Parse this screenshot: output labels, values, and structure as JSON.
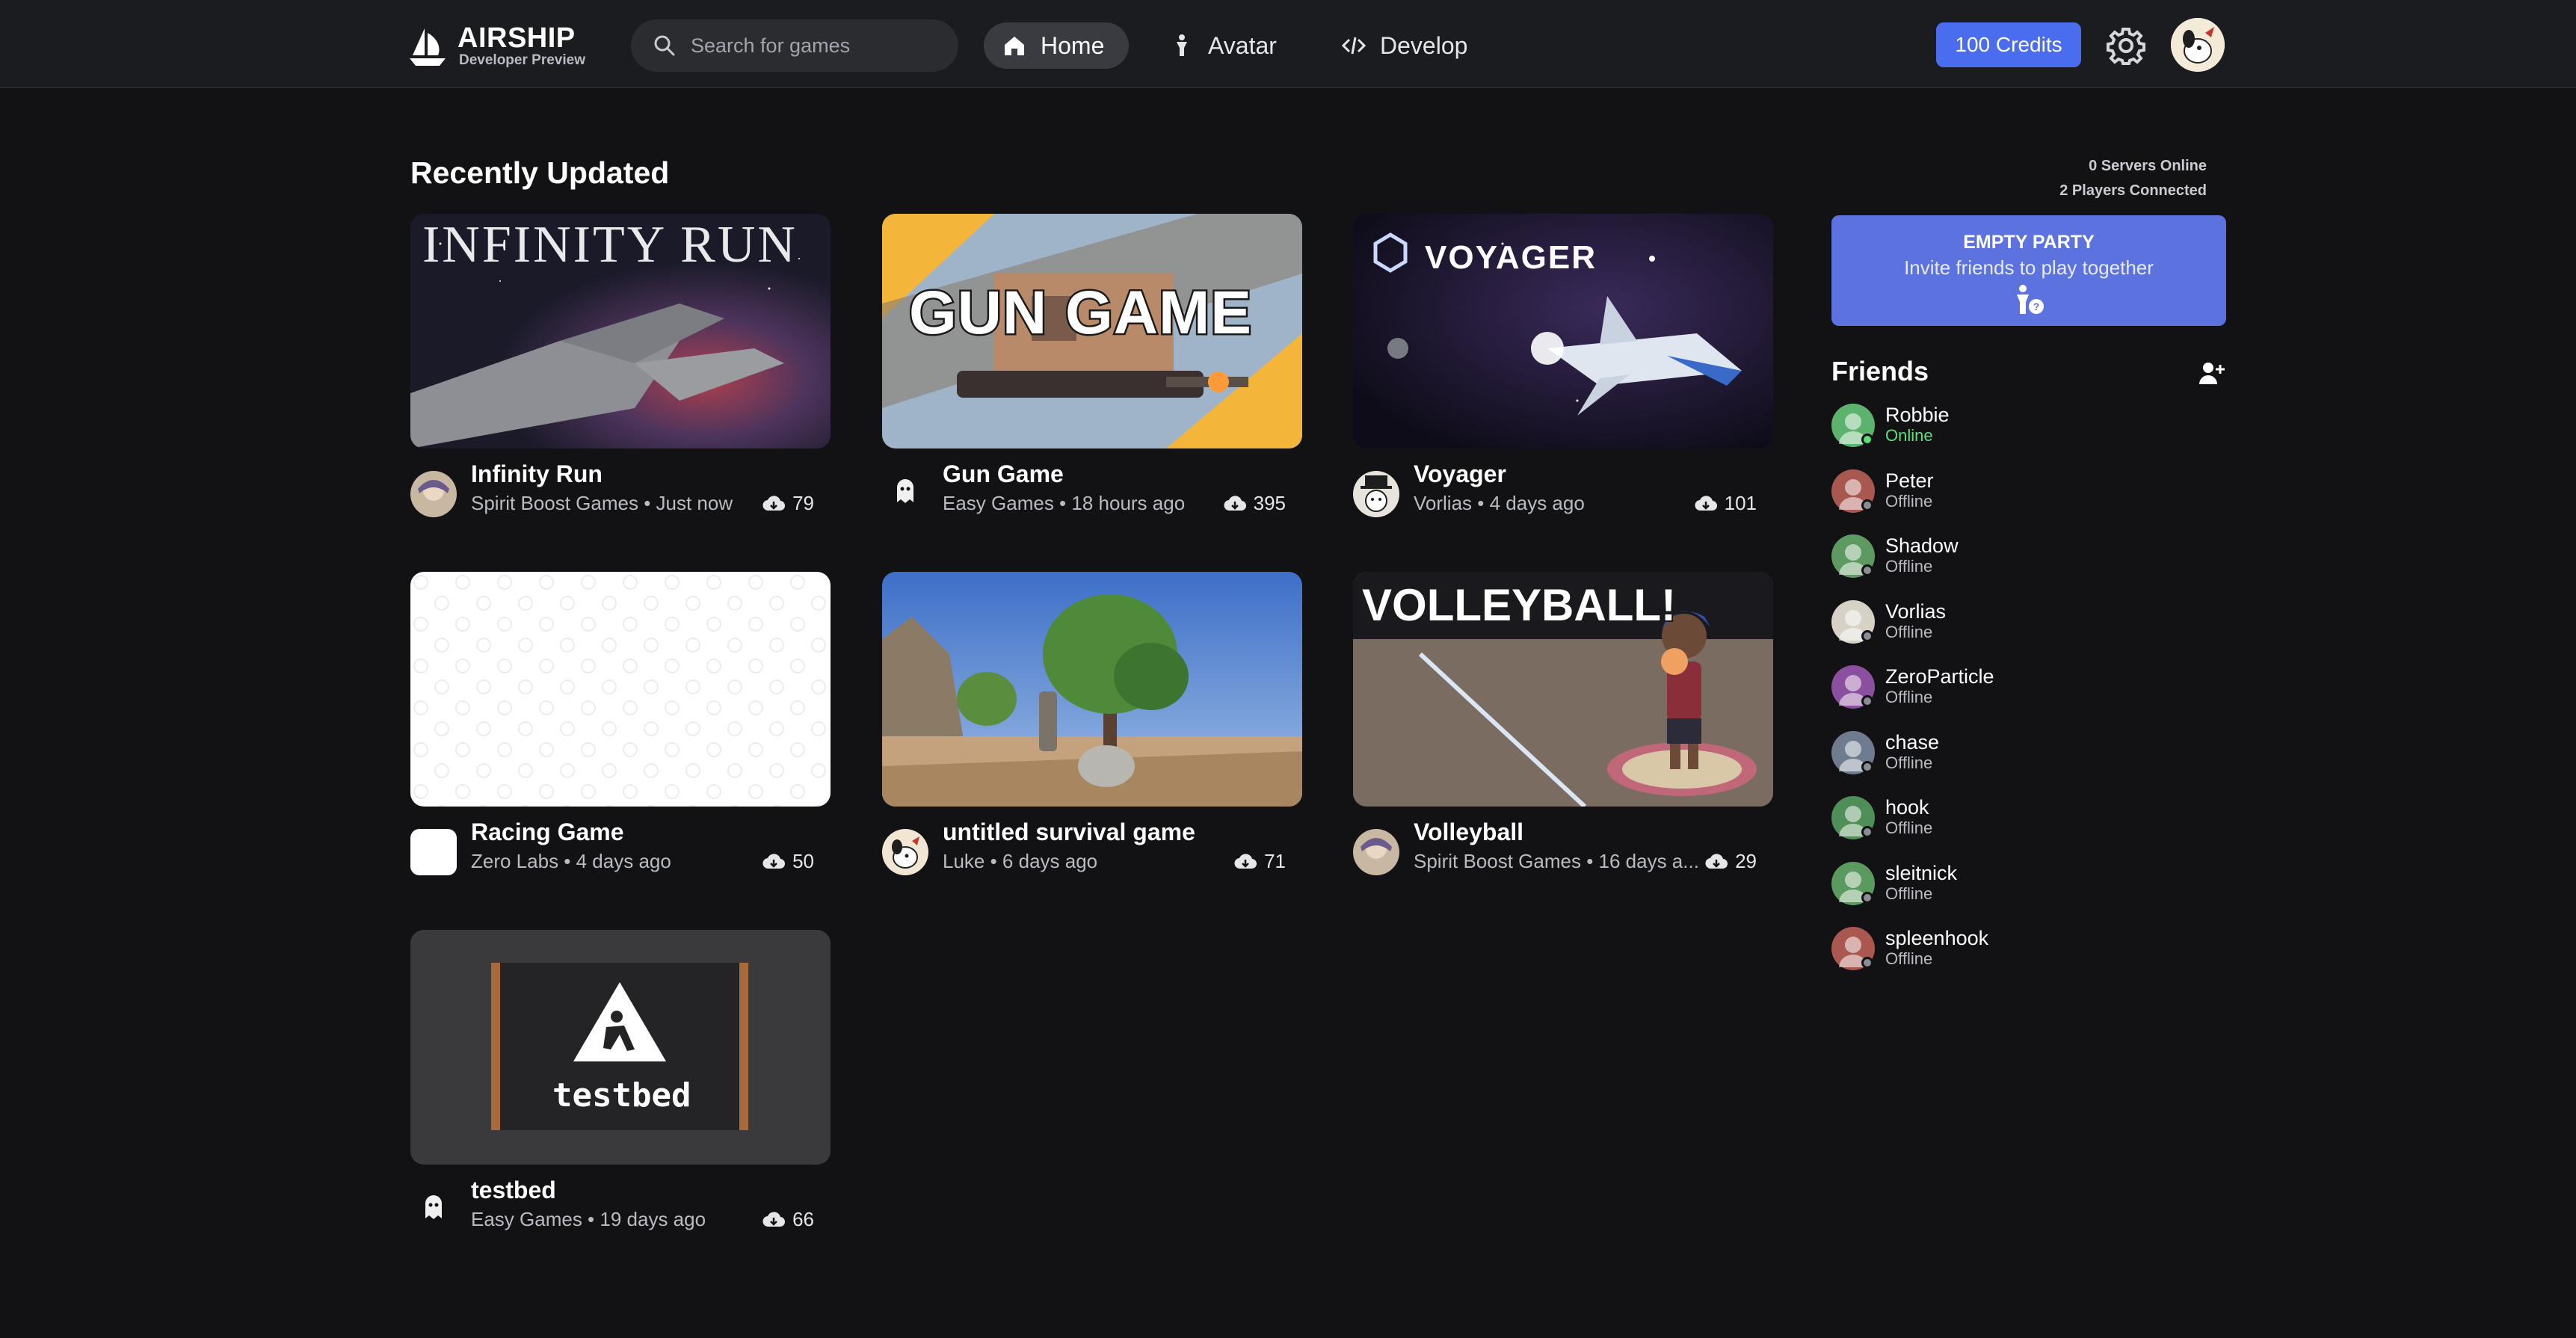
{
  "header": {
    "logo_title": "AIRSHIP",
    "logo_subtitle": "Developer Preview",
    "search_placeholder": "Search for games",
    "nav": [
      {
        "label": "Home",
        "icon": "home-icon",
        "active": true
      },
      {
        "label": "Avatar",
        "icon": "person-icon",
        "active": false
      },
      {
        "label": "Develop",
        "icon": "code-icon",
        "active": false
      }
    ],
    "credits_label": "100 Credits",
    "accent_color": "#4a6df0"
  },
  "main": {
    "section_title": "Recently Updated",
    "games": [
      {
        "name": "Infinity Run",
        "meta": "Spirit Boost Games • Just now",
        "downloads": "79",
        "thumb_title": "INFINITY RUN"
      },
      {
        "name": "Gun Game",
        "meta": "Easy Games • 18 hours ago",
        "downloads": "395",
        "thumb_title": "GUN GAME"
      },
      {
        "name": "Voyager",
        "meta": "Vorlias • 4 days ago",
        "downloads": "101",
        "thumb_title": "VOYAGER"
      },
      {
        "name": "Racing Game",
        "meta": "Zero Labs • 4 days ago",
        "downloads": "50",
        "thumb_title": ""
      },
      {
        "name": "untitled survival game",
        "meta": "Luke • 6 days ago",
        "downloads": "71",
        "thumb_title": ""
      },
      {
        "name": "Volleyball",
        "meta": "Spirit Boost Games • 16 days a...",
        "downloads": "29",
        "thumb_title": "VOLLEYBALL!"
      },
      {
        "name": "testbed",
        "meta": "Easy Games • 19 days ago",
        "downloads": "66",
        "thumb_title": "testbed"
      }
    ]
  },
  "sidebar": {
    "servers_online": "0 Servers Online",
    "players_connected": "2 Players Connected",
    "party_title": "EMPTY PARTY",
    "party_subtitle": "Invite friends to play together",
    "friends_title": "Friends",
    "friends": [
      {
        "name": "Robbie",
        "status": "Online",
        "color": "#5db36e"
      },
      {
        "name": "Peter",
        "status": "Offline",
        "color": "#a8584f"
      },
      {
        "name": "Shadow",
        "status": "Offline",
        "color": "#5d9a62"
      },
      {
        "name": "Vorlias",
        "status": "Offline",
        "color": "#d8d2c6"
      },
      {
        "name": "ZeroParticle",
        "status": "Offline",
        "color": "#8a4f9e"
      },
      {
        "name": "chase",
        "status": "Offline",
        "color": "#6f7c8f"
      },
      {
        "name": "hook",
        "status": "Offline",
        "color": "#4f8e56"
      },
      {
        "name": "sleitnick",
        "status": "Offline",
        "color": "#5a9a5e"
      },
      {
        "name": "spleenhook",
        "status": "Offline",
        "color": "#a9574f"
      }
    ]
  }
}
